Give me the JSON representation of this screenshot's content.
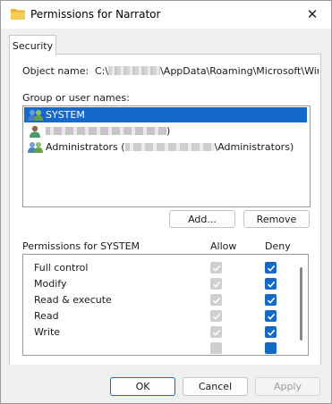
{
  "window": {
    "title": "Permissions for Narrator",
    "close_glyph": "✕"
  },
  "tab": {
    "label": "Security"
  },
  "object": {
    "label": "Object name:",
    "value_prefix": "C:\\",
    "value_suffix": "\\AppData\\Roaming\\Microsoft\\Window"
  },
  "groups": {
    "label": "Group or user names:",
    "items": [
      {
        "label": "SYSTEM",
        "selected": true,
        "icon": "user-group-icon"
      },
      {
        "label": ")",
        "selected": false,
        "icon": "user-icon"
      },
      {
        "label_prefix": "Administrators (",
        "label_suffix": "\\Administrators)",
        "selected": false,
        "icon": "user-group-icon"
      }
    ]
  },
  "buttons": {
    "add": "Add...",
    "remove": "Remove",
    "ok": "OK",
    "cancel": "Cancel",
    "apply": "Apply"
  },
  "permissions": {
    "title": "Permissions for SYSTEM",
    "allow_header": "Allow",
    "deny_header": "Deny",
    "rows": [
      {
        "name": "Full control",
        "allow": true,
        "deny": true
      },
      {
        "name": "Modify",
        "allow": true,
        "deny": true
      },
      {
        "name": "Read & execute",
        "allow": true,
        "deny": true
      },
      {
        "name": "Read",
        "allow": true,
        "deny": true
      },
      {
        "name": "Write",
        "allow": true,
        "deny": true
      }
    ]
  },
  "colors": {
    "accent": "#1469c9",
    "disabled_check": "#cfcfcf"
  }
}
